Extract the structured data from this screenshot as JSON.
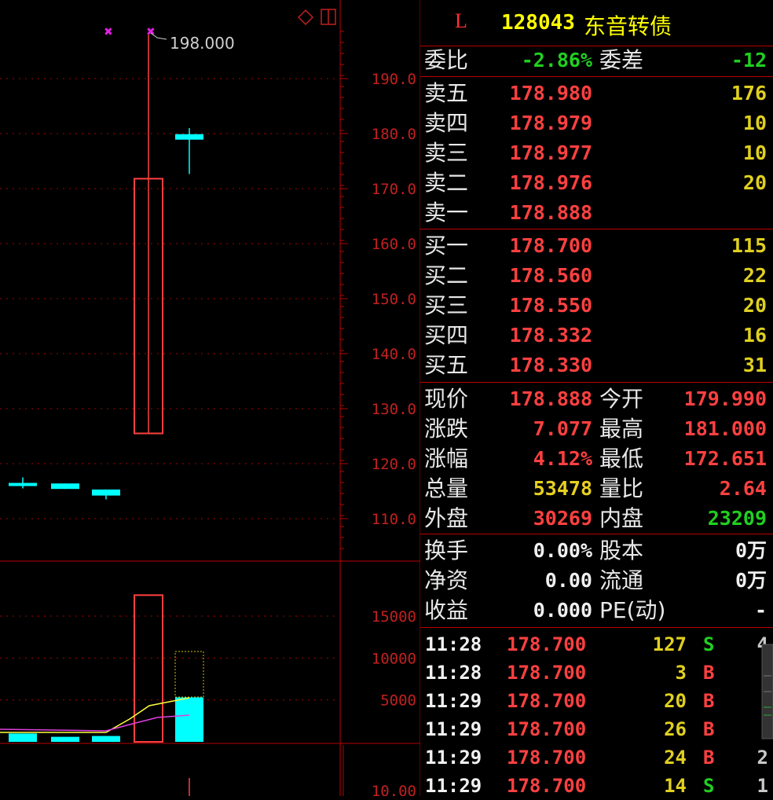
{
  "header": {
    "flag": "L",
    "code": "128043",
    "name": "东音转债"
  },
  "commission": {
    "ratio_label": "委比",
    "ratio": "-2.86%",
    "diff_label": "委差",
    "diff": "-12"
  },
  "asks": [
    {
      "label": "卖五",
      "price": "178.980",
      "volume": "176"
    },
    {
      "label": "卖四",
      "price": "178.979",
      "volume": "10"
    },
    {
      "label": "卖三",
      "price": "178.977",
      "volume": "10"
    },
    {
      "label": "卖二",
      "price": "178.976",
      "volume": "20"
    },
    {
      "label": "卖一",
      "price": "178.888",
      "volume": ""
    }
  ],
  "bids": [
    {
      "label": "买一",
      "price": "178.700",
      "volume": "115"
    },
    {
      "label": "买二",
      "price": "178.560",
      "volume": "22"
    },
    {
      "label": "买三",
      "price": "178.550",
      "volume": "20"
    },
    {
      "label": "买四",
      "price": "178.332",
      "volume": "16"
    },
    {
      "label": "买五",
      "price": "178.330",
      "volume": "31"
    }
  ],
  "quote": [
    {
      "l1": "现价",
      "v1": "178.888",
      "c1": "red",
      "l2": "今开",
      "v2": "179.990",
      "c2": "red"
    },
    {
      "l1": "涨跌",
      "v1": "7.077",
      "c1": "red",
      "l2": "最高",
      "v2": "181.000",
      "c2": "red"
    },
    {
      "l1": "涨幅",
      "v1": "4.12%",
      "c1": "red",
      "l2": "最低",
      "v2": "172.651",
      "c2": "red"
    },
    {
      "l1": "总量",
      "v1": "53478",
      "c1": "yellow",
      "l2": "量比",
      "v2": "2.64",
      "c2": "red"
    },
    {
      "l1": "外盘",
      "v1": "30269",
      "c1": "red",
      "l2": "内盘",
      "v2": "23209",
      "c2": "green"
    }
  ],
  "fundamentals": [
    {
      "l1": "换手",
      "v1": "0.00%",
      "l2": "股本",
      "v2": "0万"
    },
    {
      "l1": "净资",
      "v1": "0.00",
      "l2": "流通",
      "v2": "0万"
    },
    {
      "l1": "收益",
      "v1": "0.000",
      "l2": "PE(动)",
      "v2": "-"
    }
  ],
  "ticks": [
    {
      "time": "11:28",
      "price": "178.700",
      "vol": "127",
      "side": "S",
      "side_color": "green",
      "n": "4"
    },
    {
      "time": "11:28",
      "price": "178.700",
      "vol": "3",
      "side": "B",
      "side_color": "red",
      "n": ""
    },
    {
      "time": "11:29",
      "price": "178.700",
      "vol": "20",
      "side": "B",
      "side_color": "red",
      "n": ""
    },
    {
      "time": "11:29",
      "price": "178.700",
      "vol": "26",
      "side": "B",
      "side_color": "red",
      "n": ""
    },
    {
      "time": "11:29",
      "price": "178.700",
      "vol": "24",
      "side": "B",
      "side_color": "red",
      "n": "2"
    },
    {
      "time": "11:29",
      "price": "178.700",
      "vol": "14",
      "side": "S",
      "side_color": "green",
      "n": "1"
    }
  ],
  "chart": {
    "price_ticks": [
      "190.0",
      "180.0",
      "170.0",
      "160.0",
      "150.0",
      "140.0",
      "130.0",
      "120.0",
      "110.0"
    ],
    "price_tick_values": [
      190,
      180,
      170,
      160,
      150,
      140,
      130,
      120,
      110
    ],
    "high_marker": "198.000",
    "volume_ticks": [
      "15000",
      "10000",
      "5000"
    ],
    "volume_tick_values": [
      15000,
      10000,
      5000
    ],
    "lower_tick": "10.00",
    "candles": [
      {
        "open": 116.5,
        "close": 116.5,
        "high": 117.5,
        "low": 115.5,
        "color": "cyan"
      },
      {
        "open": 116.4,
        "close": 115.4,
        "high": 116.4,
        "low": 115.4,
        "color": "cyan"
      },
      {
        "open": 115.3,
        "close": 114.2,
        "high": 115.3,
        "low": 113.5,
        "color": "cyan"
      },
      {
        "open": 125.5,
        "close": 171.8,
        "high": 198.0,
        "low": 125.5,
        "color": "red"
      },
      {
        "open": 179.9,
        "close": 178.9,
        "high": 181.0,
        "low": 172.651,
        "color": "cyan"
      }
    ],
    "volumes": [
      1000,
      600,
      700,
      17500,
      5300
    ],
    "accent_red": "#ff4040",
    "accent_cyan": "#00ffff"
  }
}
